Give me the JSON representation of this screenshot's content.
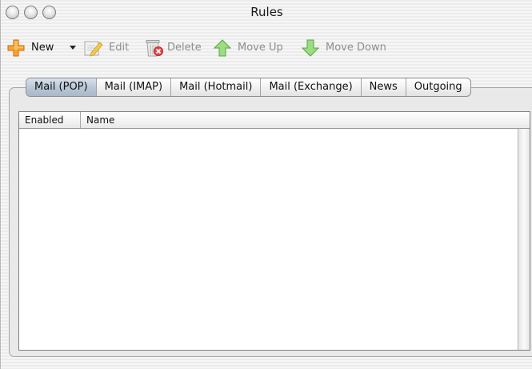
{
  "window": {
    "title": "Rules"
  },
  "toolbar": {
    "new_label": "New",
    "edit_label": "Edit",
    "delete_label": "Delete",
    "move_up_label": "Move Up",
    "move_down_label": "Move Down"
  },
  "tabs": [
    {
      "label": "Mail (POP)",
      "active": true
    },
    {
      "label": "Mail (IMAP)",
      "active": false
    },
    {
      "label": "Mail (Hotmail)",
      "active": false
    },
    {
      "label": "Mail (Exchange)",
      "active": false
    },
    {
      "label": "News",
      "active": false
    },
    {
      "label": "Outgoing",
      "active": false
    }
  ],
  "table": {
    "columns": [
      "Enabled",
      "Name"
    ],
    "rows": []
  },
  "icons": {
    "new": "plus-icon",
    "edit": "edit-icon",
    "delete": "trash-icon",
    "move_up": "arrow-up-icon",
    "move_down": "arrow-down-icon"
  },
  "colors": {
    "new_icon": "#f39a1e",
    "edit_icon": "#f0c040",
    "delete_icon": "#e04040",
    "move_icon": "#6cc24a",
    "active_tab": "#b8c6d5"
  }
}
